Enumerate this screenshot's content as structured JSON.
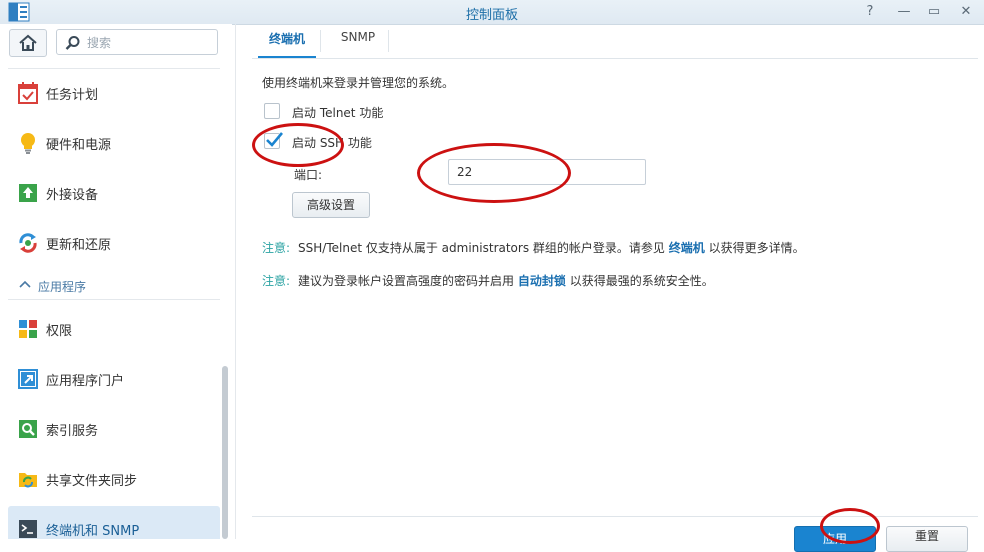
{
  "window": {
    "title": "控制面板",
    "controls": [
      "?",
      "—",
      "▭",
      "✕"
    ]
  },
  "search": {
    "placeholder": "搜索"
  },
  "sidebar": {
    "items": [
      {
        "label": "任务计划",
        "icon": "task-schedule-icon"
      },
      {
        "label": "硬件和电源",
        "icon": "lightbulb-icon"
      },
      {
        "label": "外接设备",
        "icon": "external-device-icon"
      },
      {
        "label": "更新和还原",
        "icon": "update-restore-icon"
      }
    ],
    "section": {
      "label": "应用程序"
    },
    "app_items": [
      {
        "label": "权限",
        "icon": "privileges-icon"
      },
      {
        "label": "应用程序门户",
        "icon": "app-portal-icon"
      },
      {
        "label": "索引服务",
        "icon": "indexing-icon"
      },
      {
        "label": "共享文件夹同步",
        "icon": "folder-sync-icon"
      },
      {
        "label": "终端机和 SNMP",
        "icon": "terminal-icon"
      }
    ]
  },
  "tabs": [
    {
      "label": "终端机"
    },
    {
      "label": "SNMP"
    }
  ],
  "main": {
    "description": "使用终端机来登录并管理您的系统。",
    "telnet": {
      "label": "启动 Telnet 功能",
      "checked": false
    },
    "ssh": {
      "label": "启动 SSH 功能",
      "checked": true
    },
    "port": {
      "label": "端口:",
      "value": "22"
    },
    "advanced_button": "高级设置",
    "note1": {
      "key": "注意:",
      "text": "SSH/Telnet 仅支持从属于 administrators 群组的帐户登录。请参见",
      "link": "终端机",
      "tail": "以获得更多详情。"
    },
    "note2": {
      "key": "注意:",
      "text": "建议为登录帐户设置高强度的密码并启用",
      "link": "自动封锁",
      "tail": "以获得最强的系统安全性。"
    }
  },
  "footer": {
    "apply": "应用",
    "reset": "重置"
  },
  "colors": {
    "accent": "#1a84d0",
    "link": "#1a6fb0",
    "note": "#2ba3a3",
    "annotation": "#cc1111",
    "active_bg": "#dbe9f6"
  }
}
